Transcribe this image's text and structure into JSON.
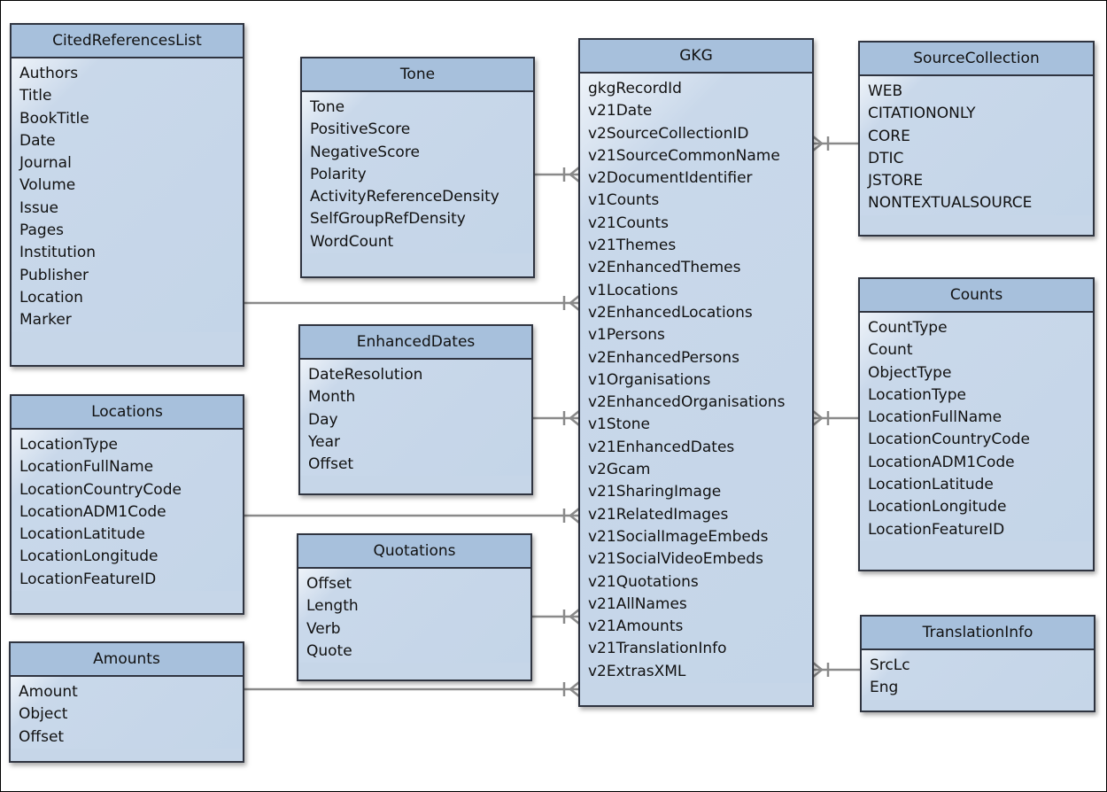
{
  "diagram": {
    "entities": {
      "cited": {
        "name": "CitedReferencesList",
        "fields": [
          "Authors",
          "Title",
          "BookTitle",
          "Date",
          "Journal",
          "Volume",
          "Issue",
          "Pages",
          "Institution",
          "Publisher",
          "Location",
          "Marker"
        ]
      },
      "tone": {
        "name": "Tone",
        "fields": [
          "Tone",
          "PositiveScore",
          "NegativeScore",
          "Polarity",
          "ActivityReferenceDensity",
          "SelfGroupRefDensity",
          "WordCount"
        ]
      },
      "gkg": {
        "name": "GKG",
        "fields": [
          "gkgRecordId",
          "v21Date",
          "v2SourceCollectionID",
          "v21SourceCommonName",
          "v2DocumentIdentifier",
          "v1Counts",
          "v21Counts",
          "v21Themes",
          "v2EnhancedThemes",
          "v1Locations",
          "v2EnhancedLocations",
          "v1Persons",
          "v2EnhancedPersons",
          "v1Organisations",
          "v2EnhancedOrganisations",
          "v1Stone",
          "v21EnhancedDates",
          "v2Gcam",
          "v21SharingImage",
          "v21RelatedImages",
          "v21SocialImageEmbeds",
          "v21SocialVideoEmbeds",
          "v21Quotations",
          "v21AllNames",
          "v21Amounts",
          "v21TranslationInfo",
          "v2ExtrasXML"
        ]
      },
      "source": {
        "name": "SourceCollection",
        "fields": [
          "WEB",
          "CITATIONONLY",
          "CORE",
          "DTIC",
          "JSTORE",
          "NONTEXTUALSOURCE"
        ]
      },
      "dates": {
        "name": "EnhancedDates",
        "fields": [
          "DateResolution",
          "Month",
          "Day",
          "Year",
          "Offset"
        ]
      },
      "locations": {
        "name": "Locations",
        "fields": [
          "LocationType",
          "LocationFullName",
          "LocationCountryCode",
          "LocationADM1Code",
          "LocationLatitude",
          "LocationLongitude",
          "LocationFeatureID"
        ]
      },
      "counts": {
        "name": "Counts",
        "fields": [
          "CountType",
          "Count",
          "ObjectType",
          "LocationType",
          "LocationFullName",
          "LocationCountryCode",
          "LocationADM1Code",
          "LocationLatitude",
          "LocationLongitude",
          "LocationFeatureID"
        ]
      },
      "quotations": {
        "name": "Quotations",
        "fields": [
          "Offset",
          "Length",
          "Verb",
          "Quote"
        ]
      },
      "amounts": {
        "name": "Amounts",
        "fields": [
          "Amount",
          "Object",
          "Offset"
        ]
      },
      "translation": {
        "name": "TranslationInfo",
        "fields": [
          "SrcLc",
          "Eng"
        ]
      }
    },
    "relationships": [
      {
        "from": "Tone",
        "to": "GKG",
        "notation": "one-to-many"
      },
      {
        "from": "CitedReferencesList",
        "to": "GKG",
        "notation": "one-to-many"
      },
      {
        "from": "EnhancedDates",
        "to": "GKG",
        "notation": "one-to-many"
      },
      {
        "from": "Locations",
        "to": "GKG",
        "notation": "one-to-many"
      },
      {
        "from": "Quotations",
        "to": "GKG",
        "notation": "one-to-many"
      },
      {
        "from": "Amounts",
        "to": "GKG",
        "notation": "one-to-many"
      },
      {
        "from": "SourceCollection",
        "to": "GKG",
        "notation": "one-to-many"
      },
      {
        "from": "Counts",
        "to": "GKG",
        "notation": "one-to-many"
      },
      {
        "from": "TranslationInfo",
        "to": "GKG",
        "notation": "one-to-many"
      }
    ],
    "colors": {
      "header": "#a7c0dc",
      "body": "#c6d6e8",
      "border": "#2f3440",
      "connector": "#8a8a8a"
    }
  }
}
